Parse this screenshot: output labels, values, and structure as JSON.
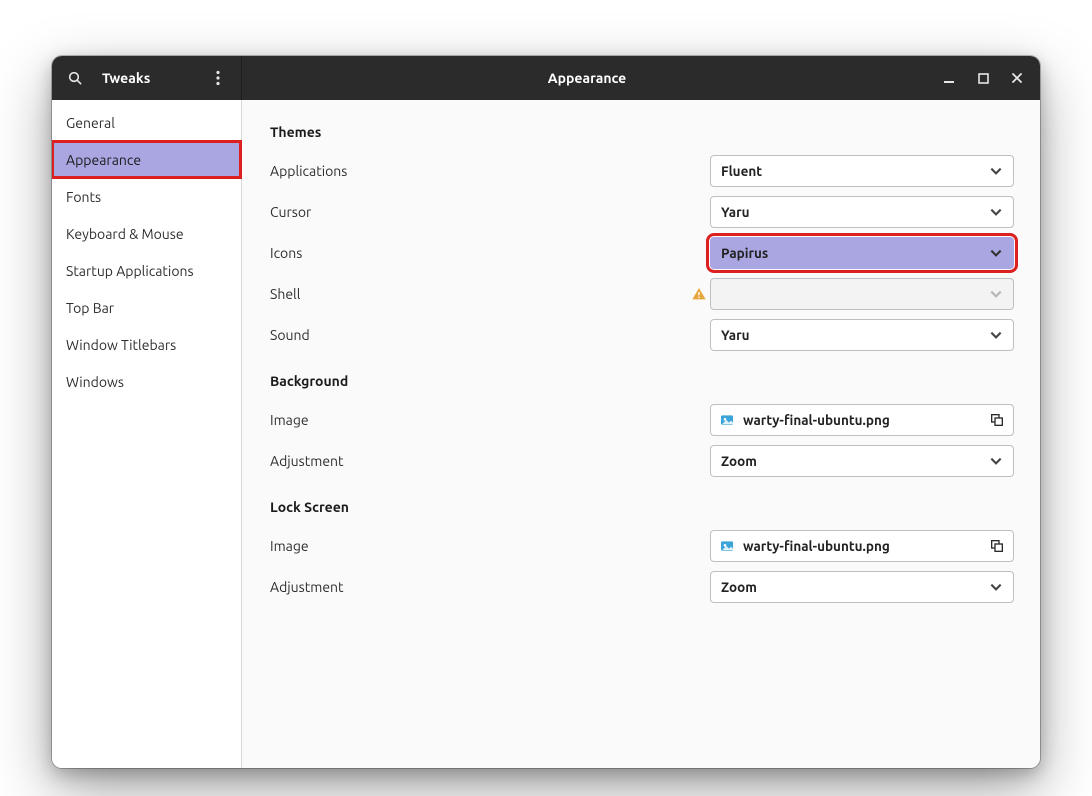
{
  "titlebar": {
    "left_title": "Tweaks",
    "center_title": "Appearance"
  },
  "sidebar": {
    "items": [
      "General",
      "Appearance",
      "Fonts",
      "Keyboard & Mouse",
      "Startup Applications",
      "Top Bar",
      "Window Titlebars",
      "Windows"
    ],
    "selected_index": 1
  },
  "sections": {
    "themes": {
      "title": "Themes",
      "applications": {
        "label": "Applications",
        "value": "Fluent"
      },
      "cursor": {
        "label": "Cursor",
        "value": "Yaru"
      },
      "icons": {
        "label": "Icons",
        "value": "Papirus"
      },
      "shell": {
        "label": "Shell",
        "value": ""
      },
      "sound": {
        "label": "Sound",
        "value": "Yaru"
      }
    },
    "background": {
      "title": "Background",
      "image": {
        "label": "Image",
        "value": "warty-final-ubuntu.png"
      },
      "adjustment": {
        "label": "Adjustment",
        "value": "Zoom"
      }
    },
    "lockscreen": {
      "title": "Lock Screen",
      "image": {
        "label": "Image",
        "value": "warty-final-ubuntu.png"
      },
      "adjustment": {
        "label": "Adjustment",
        "value": "Zoom"
      }
    }
  }
}
